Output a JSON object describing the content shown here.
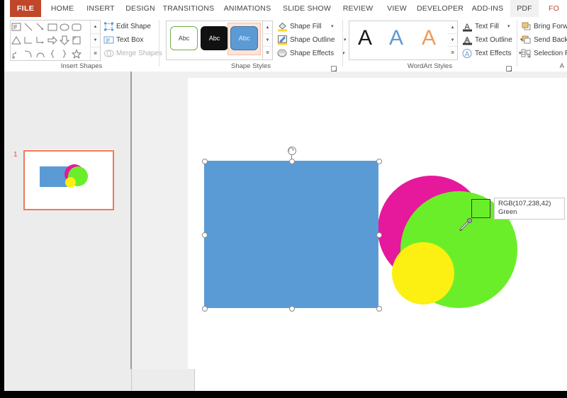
{
  "window": {
    "app": "PowerPoint",
    "context_tab": "FORMAT"
  },
  "ribbon": {
    "tabs": [
      {
        "label": "FILE",
        "name": "tab-file",
        "active": false,
        "file": true
      },
      {
        "label": "HOME",
        "name": "tab-home",
        "active": false
      },
      {
        "label": "INSERT",
        "name": "tab-insert",
        "active": false
      },
      {
        "label": "DESIGN",
        "name": "tab-design",
        "active": false
      },
      {
        "label": "TRANSITIONS",
        "name": "tab-transitions",
        "active": false
      },
      {
        "label": "ANIMATIONS",
        "name": "tab-animations",
        "active": false
      },
      {
        "label": "SLIDE SHOW",
        "name": "tab-slide-show",
        "active": false
      },
      {
        "label": "REVIEW",
        "name": "tab-review",
        "active": false
      },
      {
        "label": "VIEW",
        "name": "tab-view",
        "active": false
      },
      {
        "label": "DEVELOPER",
        "name": "tab-developer",
        "active": false
      },
      {
        "label": "ADD-INS",
        "name": "tab-add-ins",
        "active": false
      },
      {
        "label": "PDF",
        "name": "tab-pdf",
        "active": true
      },
      {
        "label": "FO",
        "name": "tab-format",
        "active": false
      }
    ],
    "groups": {
      "insert_shapes": {
        "title": "Insert Shapes",
        "commands": [
          {
            "label": "Edit Shape",
            "icon": "edit-shape-icon",
            "arrow": "▾",
            "disabled": false
          },
          {
            "label": "Text Box",
            "icon": "text-box-icon",
            "arrow": "",
            "disabled": false
          },
          {
            "label": "Merge Shapes",
            "icon": "merge-shapes-icon",
            "arrow": "▾",
            "disabled": true
          }
        ],
        "scroll": [
          "▲",
          "▼",
          "≣"
        ]
      },
      "shape_styles": {
        "title": "Shape Styles",
        "thumbs": [
          {
            "label": "Abc",
            "fill": "#ffffff",
            "border": "#70ad47",
            "text": "#444444",
            "selected": false
          },
          {
            "label": "Abc",
            "fill": "#111111",
            "border": "#111111",
            "text": "#ffffff",
            "selected": false
          },
          {
            "label": "Abc",
            "fill": "#5b9bd5",
            "border": "#41719c",
            "text": "#eaf2fa",
            "selected": true
          }
        ],
        "commands": [
          {
            "label": "Shape Fill",
            "icon": "shape-fill-icon",
            "arrow": "▾"
          },
          {
            "label": "Shape Outline",
            "icon": "shape-outline-icon",
            "arrow": "▾"
          },
          {
            "label": "Shape Effects",
            "icon": "shape-effects-icon",
            "arrow": "▾"
          }
        ],
        "scroll": [
          "▲",
          "▼",
          "≣"
        ]
      },
      "wordart_styles": {
        "title": "WordArt Styles",
        "thumbs": [
          {
            "label": "A",
            "color": "#1a1a1a"
          },
          {
            "label": "A",
            "color": "#5b9bd5"
          },
          {
            "label": "A",
            "color": "#ed9b5a"
          }
        ],
        "commands": [
          {
            "label": "Text Fill",
            "icon": "text-fill-icon",
            "arrow": "▾"
          },
          {
            "label": "Text Outline",
            "icon": "text-outline-icon",
            "arrow": "▾"
          },
          {
            "label": "Text Effects",
            "icon": "text-effects-icon",
            "arrow": "▾"
          }
        ],
        "scroll": [
          "▲",
          "▼",
          "≣"
        ]
      },
      "arrange": {
        "title": "A",
        "commands": [
          {
            "label": "Bring Forwa",
            "icon": "bring-forward-icon",
            "arrow": ""
          },
          {
            "label": "Send Backw",
            "icon": "send-backward-icon",
            "arrow": ""
          },
          {
            "label": "Selection P",
            "icon": "selection-pane-icon",
            "arrow": ""
          }
        ]
      }
    }
  },
  "slides_pane": {
    "slides": [
      {
        "number": "1",
        "selected": true
      }
    ]
  },
  "slide": {
    "shapes": [
      {
        "name": "blue-rectangle",
        "type": "rect",
        "fill": "#5b9bd5",
        "selected": true
      },
      {
        "name": "magenta-circle",
        "type": "circle",
        "fill": "#e6189c",
        "selected": false
      },
      {
        "name": "green-circle",
        "type": "circle",
        "fill": "#6bee2a",
        "selected": false
      },
      {
        "name": "yellow-circle",
        "type": "circle",
        "fill": "#fbf011",
        "selected": false
      }
    ]
  },
  "eyedropper": {
    "cursor": "eyedropper-cursor",
    "swatch_color": "#6bee2a",
    "rgb_text": "RGB(107,238,42)",
    "color_name": "Green"
  }
}
